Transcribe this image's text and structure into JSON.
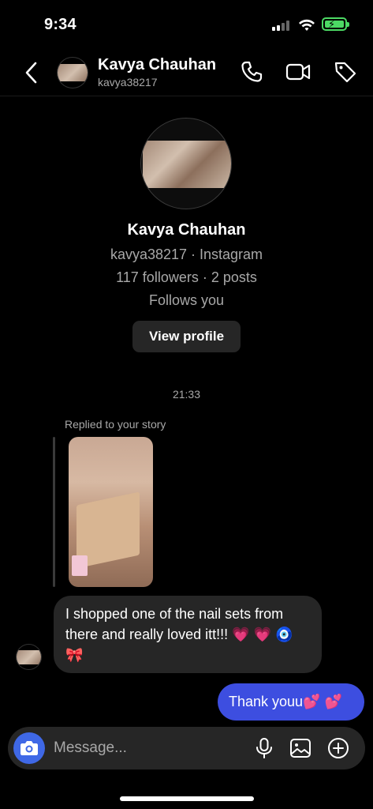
{
  "status": {
    "time": "9:34"
  },
  "header": {
    "name": "Kavya Chauhan",
    "username": "kavya38217"
  },
  "profile": {
    "name": "Kavya Chauhan",
    "line1": "kavya38217 · Instagram",
    "line2": "117 followers · 2 posts",
    "line3": "Follows you",
    "view_button": "View profile"
  },
  "thread": {
    "timestamp": "21:33",
    "reply_label": "Replied to your story",
    "incoming": "I shopped one of the nail sets from there and really loved itt!!! 💗 💗 🧿 🎀",
    "outgoing": "Thank youu💕 💕"
  },
  "composer": {
    "placeholder": "Message..."
  },
  "colors": {
    "outgoing_bubble": "#3d4ee0",
    "camera_button": "#3f68e6",
    "incoming_bubble": "#262626"
  }
}
